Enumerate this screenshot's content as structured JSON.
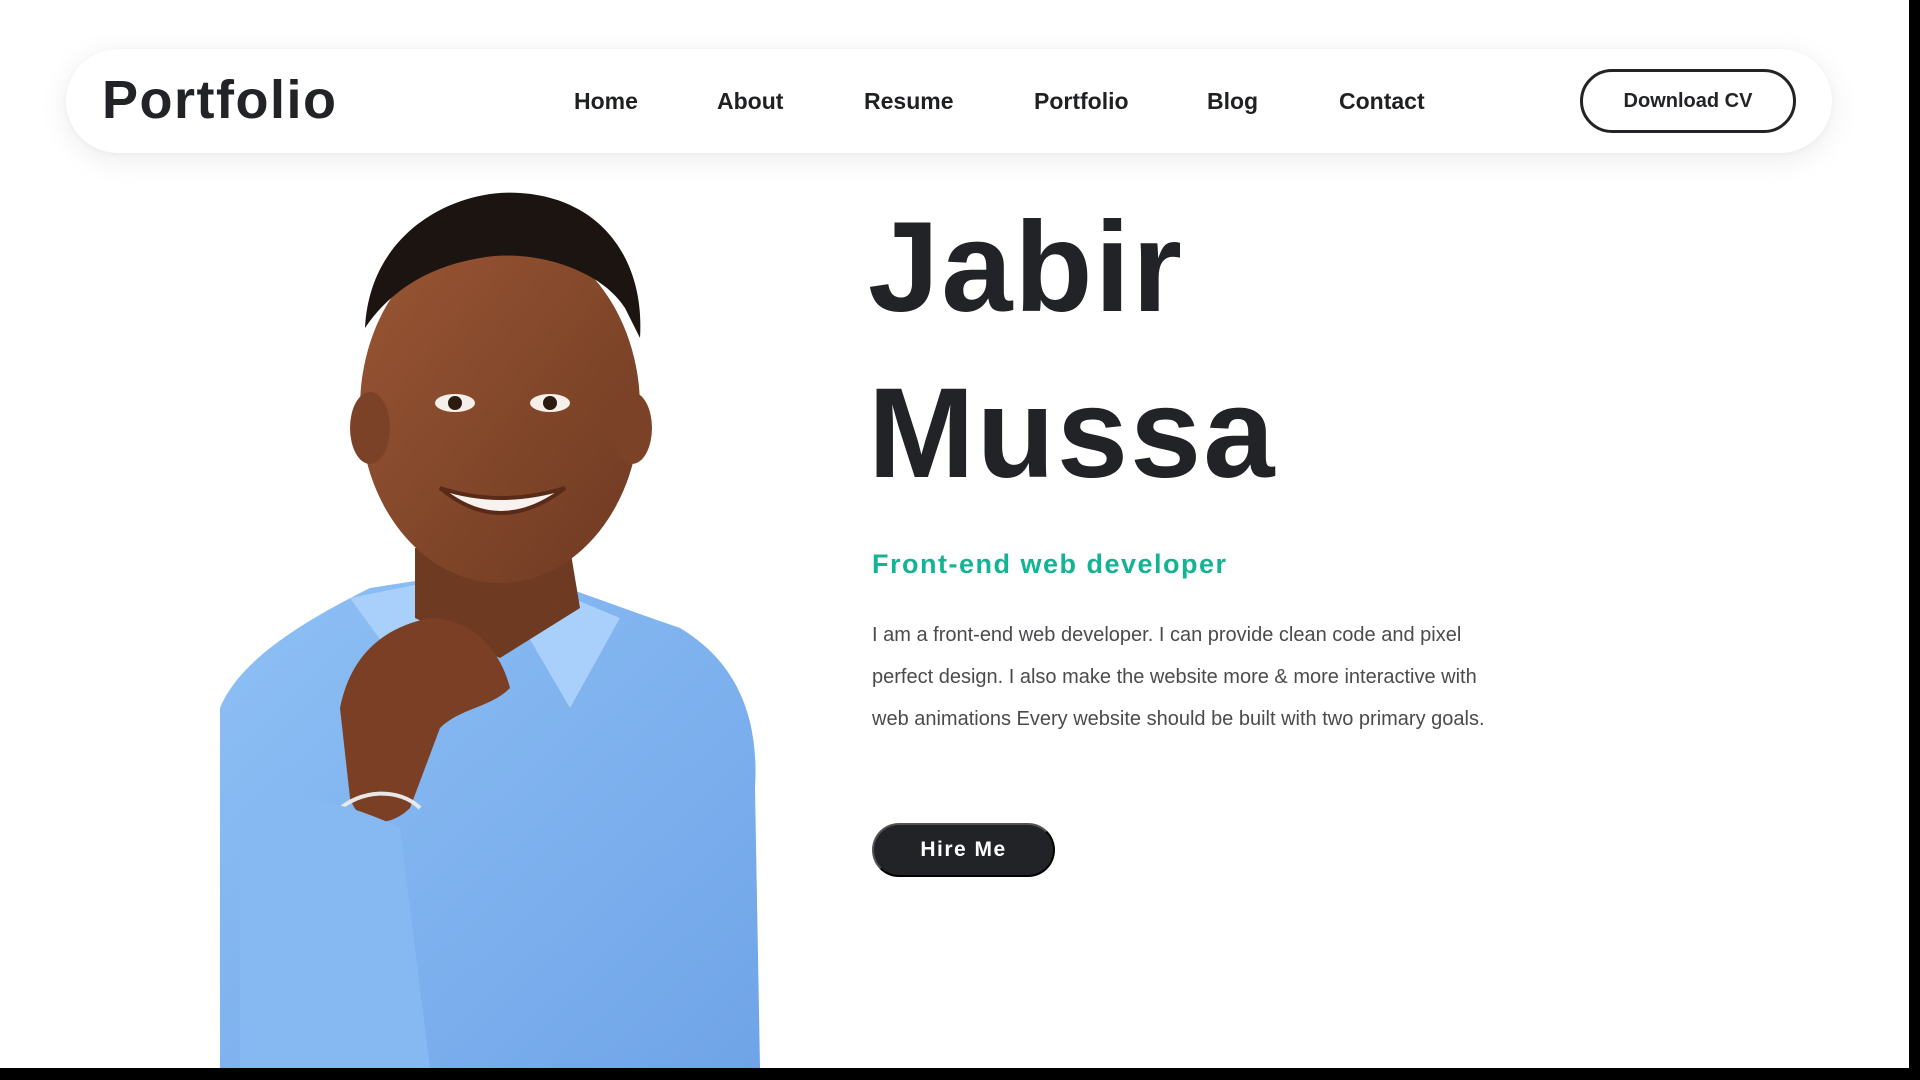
{
  "header": {
    "logo": "Portfolio",
    "nav": [
      "Home",
      "About",
      "Resume",
      "Portfolio",
      "Blog",
      "Contact"
    ],
    "cta_label": "Download CV"
  },
  "hero": {
    "first_name": "Jabir",
    "last_name": "Mussa",
    "role": "Front-end web developer",
    "bio": "I am a front-end web developer. I can provide clean code and pixel perfect design. I also make the website more & more interactive with web animations Every website should be built with two primary goals.",
    "hire_label": "Hire Me"
  },
  "colors": {
    "accent": "#14b394",
    "dark": "#222326",
    "shirt": "#7fb2ef",
    "skin": "#8a4a2a"
  }
}
